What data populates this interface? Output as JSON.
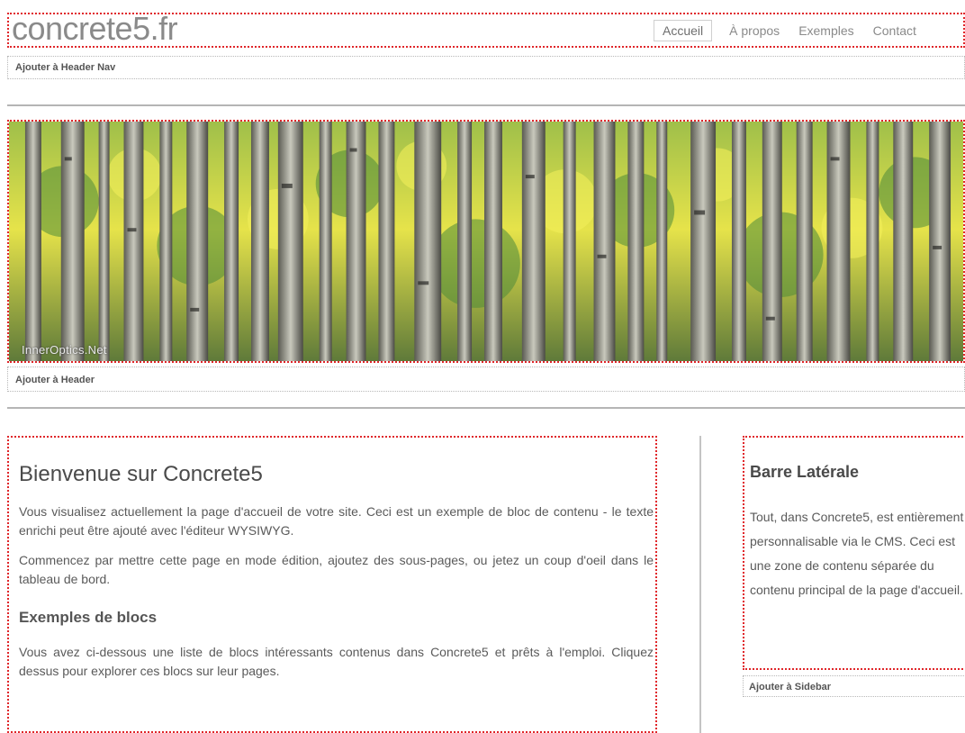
{
  "site": {
    "title": "concrete5.fr"
  },
  "nav": {
    "items": [
      {
        "label": "Accueil",
        "active": true
      },
      {
        "label": "À propos"
      },
      {
        "label": "Exemples"
      },
      {
        "label": "Contact"
      }
    ],
    "add_label": "Ajouter à Header Nav"
  },
  "banner": {
    "credit": "InnerOptics.Net",
    "add_label": "Ajouter à Header"
  },
  "main": {
    "heading": "Bienvenue sur Concrete5",
    "paragraphs": [
      "Vous visualisez actuellement la page d'accueil de votre site. Ceci est un exemple de bloc de contenu - le texte enrichi peut être ajouté avec l'éditeur WYSIWYG.",
      "Commencez par mettre cette page en mode édition, ajoutez des sous-pages, ou jetez un coup d'oeil dans le tableau de bord."
    ],
    "blocks_heading": "Exemples de blocs",
    "blocks_text": "Vous avez ci-dessous une liste de blocs intéressants contenus dans Concrete5 et prêts à l'emploi. Cliquez dessus pour explorer ces blocs sur leur pages."
  },
  "sidebar": {
    "heading": "Barre Latérale",
    "text": "Tout, dans Concrete5, est entièrement personnalisable via le CMS. Ceci est une zone de contenu séparée du contenu principal de la page d'accueil.",
    "add_label": "Ajouter à Sidebar"
  },
  "colors": {
    "area_outline": "#e0262a",
    "rule": "#b5b5b5",
    "text": "#555555"
  }
}
